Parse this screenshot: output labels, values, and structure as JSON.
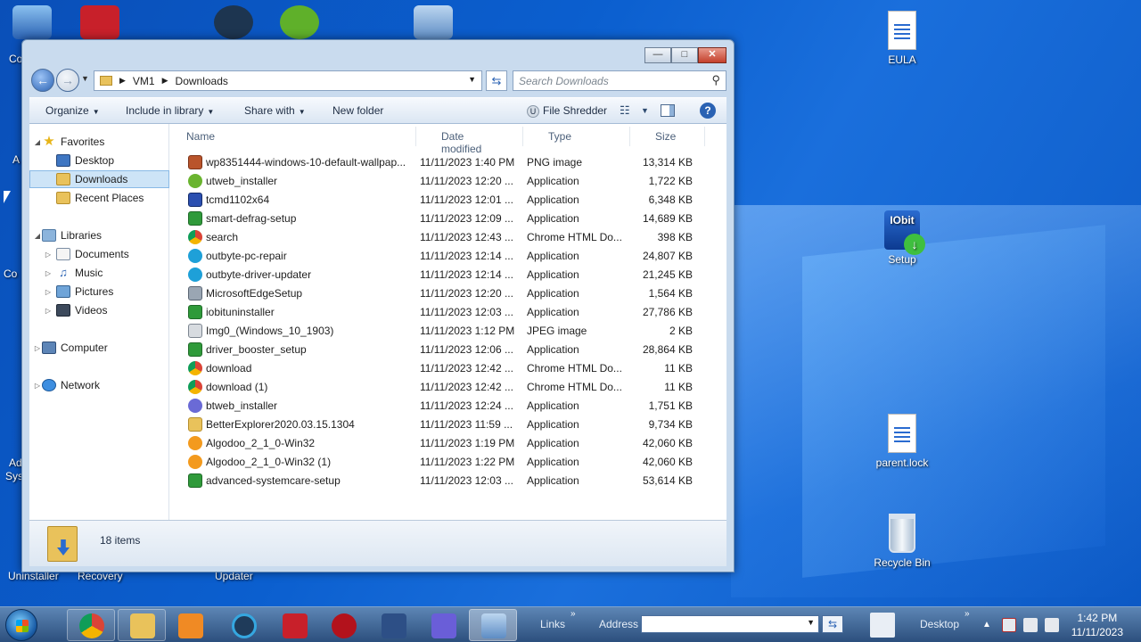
{
  "desktop": {
    "icons": [
      {
        "label": "EULA"
      },
      {
        "label": "Setup",
        "badge": "IObit"
      },
      {
        "label": "parent.lock"
      },
      {
        "label": "Recycle Bin"
      }
    ],
    "left_edge_labels": [
      "Co",
      "A",
      "Co",
      "Ad",
      "Syst",
      "Uninstaller",
      "Recovery",
      "Updater"
    ]
  },
  "window": {
    "controls": {
      "minimize": "—",
      "maximize": "□",
      "close": "✕"
    },
    "address": {
      "crumbs": [
        "VM1",
        "Downloads"
      ]
    },
    "search_placeholder": "Search Downloads",
    "toolbar": {
      "organize": "Organize",
      "include_in_library": "Include in library",
      "share_with": "Share with",
      "new_folder": "New folder",
      "file_shredder": "File Shredder"
    },
    "nav": {
      "favorites": "Favorites",
      "desktop": "Desktop",
      "downloads": "Downloads",
      "recent_places": "Recent Places",
      "libraries": "Libraries",
      "documents": "Documents",
      "music": "Music",
      "pictures": "Pictures",
      "videos": "Videos",
      "computer": "Computer",
      "network": "Network"
    },
    "columns": {
      "name": "Name",
      "date": "Date modified",
      "type": "Type",
      "size": "Size"
    },
    "files": [
      {
        "name": "wp8351444-windows-10-default-wallpap...",
        "date": "11/11/2023 1:40 PM",
        "type": "PNG image",
        "size": "13,314 KB",
        "icon": "png-icon"
      },
      {
        "name": "utweb_installer",
        "date": "11/11/2023 12:20 ...",
        "type": "Application",
        "size": "1,722 KB",
        "icon": "utweb-icon"
      },
      {
        "name": "tcmd1102x64",
        "date": "11/11/2023 12:01 ...",
        "type": "Application",
        "size": "6,348 KB",
        "icon": "disk-icon"
      },
      {
        "name": "smart-defrag-setup",
        "date": "11/11/2023 12:09 ...",
        "type": "Application",
        "size": "14,689 KB",
        "icon": "installer-icon"
      },
      {
        "name": "search",
        "date": "11/11/2023 12:43 ...",
        "type": "Chrome HTML Do...",
        "size": "398 KB",
        "icon": "chrome-icon"
      },
      {
        "name": "outbyte-pc-repair",
        "date": "11/11/2023 12:14 ...",
        "type": "Application",
        "size": "24,807 KB",
        "icon": "outbyte-icon"
      },
      {
        "name": "outbyte-driver-updater",
        "date": "11/11/2023 12:14 ...",
        "type": "Application",
        "size": "21,245 KB",
        "icon": "outbyte-icon"
      },
      {
        "name": "MicrosoftEdgeSetup",
        "date": "11/11/2023 12:20 ...",
        "type": "Application",
        "size": "1,564 KB",
        "icon": "edge-setup-icon"
      },
      {
        "name": "iobituninstaller",
        "date": "11/11/2023 12:03 ...",
        "type": "Application",
        "size": "27,786 KB",
        "icon": "installer-icon"
      },
      {
        "name": "Img0_(Windows_10_1903)",
        "date": "11/11/2023 1:12 PM",
        "type": "JPEG image",
        "size": "2 KB",
        "icon": "jpeg-icon"
      },
      {
        "name": "driver_booster_setup",
        "date": "11/11/2023 12:06 ...",
        "type": "Application",
        "size": "28,864 KB",
        "icon": "installer-icon"
      },
      {
        "name": "download",
        "date": "11/11/2023 12:42 ...",
        "type": "Chrome HTML Do...",
        "size": "11 KB",
        "icon": "chrome-icon"
      },
      {
        "name": "download (1)",
        "date": "11/11/2023 12:42 ...",
        "type": "Chrome HTML Do...",
        "size": "11 KB",
        "icon": "chrome-icon"
      },
      {
        "name": "btweb_installer",
        "date": "11/11/2023 12:24 ...",
        "type": "Application",
        "size": "1,751 KB",
        "icon": "btweb-icon"
      },
      {
        "name": "BetterExplorer2020.03.15.1304",
        "date": "11/11/2023 11:59 ...",
        "type": "Application",
        "size": "9,734 KB",
        "icon": "folder-app-icon"
      },
      {
        "name": "Algodoo_2_1_0-Win32",
        "date": "11/11/2023 1:19 PM",
        "type": "Application",
        "size": "42,060 KB",
        "icon": "algodoo-icon"
      },
      {
        "name": "Algodoo_2_1_0-Win32 (1)",
        "date": "11/11/2023 1:22 PM",
        "type": "Application",
        "size": "42,060 KB",
        "icon": "algodoo-icon"
      },
      {
        "name": "advanced-systemcare-setup",
        "date": "11/11/2023 12:03 ...",
        "type": "Application",
        "size": "53,614 KB",
        "icon": "installer-icon"
      }
    ],
    "item_count": "18 items"
  },
  "taskbar": {
    "links": "Links",
    "address_label": "Address",
    "desktop_label": "Desktop",
    "time": "1:42 PM",
    "date": "11/11/2023",
    "apps": [
      "chrome-icon",
      "explorer-icon",
      "media-player-icon",
      "ccleaner-icon",
      "recorder-icon",
      "game-icon",
      "network-tool-icon",
      "parallels-icon",
      "control-panel-icon"
    ]
  }
}
